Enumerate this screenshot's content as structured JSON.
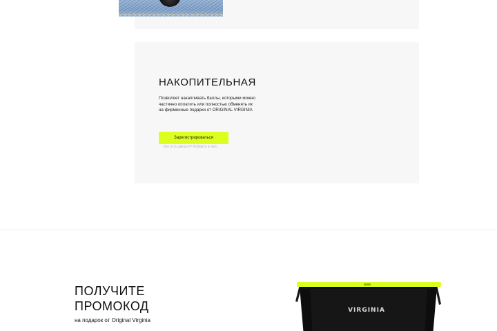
{
  "previous_card": {
    "image": "denim-fabric-photo"
  },
  "loyalty_card": {
    "title": "НАКОПИТЕЛЬНАЯ",
    "description": "Позволяет накапливать баллы, которыми можно частично оплатить или полностью обменять их на фирменные подарки от ORIGINAL VIRGINIA",
    "register_label": "Зарегистрироваться",
    "login_hint": "Уже есть аккаунт? Войдите в него",
    "accent_color": "#dcff1f"
  },
  "promo": {
    "title": "ПОЛУЧИТЕ ПРОМОКОД",
    "subtitle": "на подарок от Original Virginia",
    "product_image": "virginia-black-bag",
    "product_brand": "VIRGINIA"
  },
  "colors": {
    "card_background": "#f7f7f7",
    "accent": "#dcff1f",
    "text": "#111111"
  }
}
